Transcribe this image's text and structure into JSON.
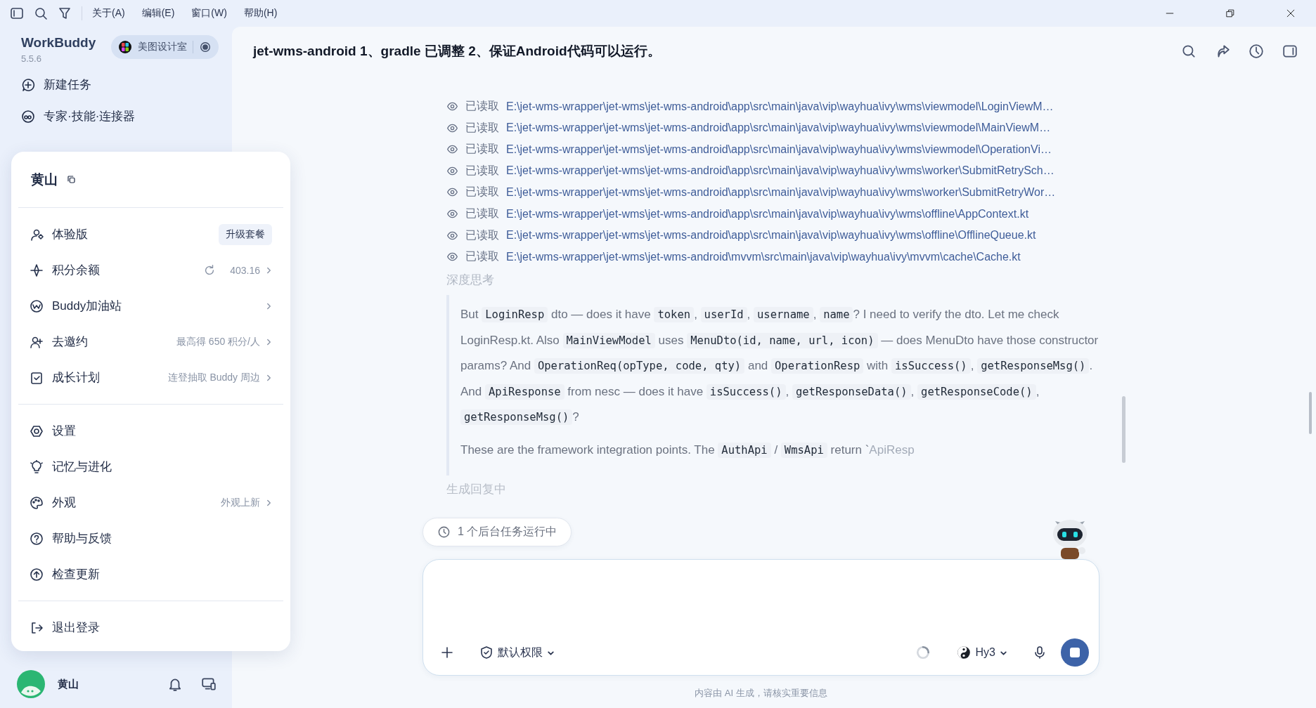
{
  "menu_bar": {
    "items": [
      "关于(A)",
      "编辑(E)",
      "窗口(W)",
      "帮助(H)"
    ]
  },
  "sidebar": {
    "app_name": "WorkBuddy",
    "version": "5.5.6",
    "workspace": "美图设计室",
    "items": [
      {
        "label": "新建任务"
      },
      {
        "label": "专家·技能·连接器"
      }
    ],
    "user": {
      "name": "黄山"
    }
  },
  "account_menu": {
    "user_name": "黄山",
    "groups": [
      [
        {
          "kind": "upgrade",
          "label": "体验版",
          "action": "升级套餐",
          "chevron": false
        },
        {
          "kind": "balance",
          "label": "积分余额",
          "detail": "403.16",
          "chevron": true
        },
        {
          "kind": "plain",
          "label": "Buddy加油站",
          "chevron": true
        },
        {
          "kind": "plain",
          "label": "去邀约",
          "detail": "最高得 650 积分/人",
          "chevron": true
        },
        {
          "kind": "plain",
          "label": "成长计划",
          "detail": "连登抽取 Buddy 周边",
          "chevron": true
        }
      ],
      [
        {
          "kind": "plain",
          "label": "设置",
          "chevron": false
        },
        {
          "kind": "plain",
          "label": "记忆与进化",
          "chevron": false
        },
        {
          "kind": "plain",
          "label": "外观",
          "detail": "外观上新",
          "chevron": true
        },
        {
          "kind": "plain",
          "label": "帮助与反馈",
          "chevron": false
        },
        {
          "kind": "plain",
          "label": "检查更新",
          "chevron": false
        }
      ],
      [
        {
          "kind": "plain",
          "label": "退出登录",
          "chevron": false
        }
      ]
    ]
  },
  "conversation": {
    "title": "jet-wms-android 1、gradle 已调整 2、保证Android代码可以运行。",
    "file_reads": [
      {
        "status": "已读取",
        "path": "E:\\jet-wms-wrapper\\jet-wms\\jet-wms-android\\app\\src\\main\\java\\vip\\wayhua\\ivy\\wms\\viewmodel\\LoginViewM…"
      },
      {
        "status": "已读取",
        "path": "E:\\jet-wms-wrapper\\jet-wms\\jet-wms-android\\app\\src\\main\\java\\vip\\wayhua\\ivy\\wms\\viewmodel\\MainViewM…"
      },
      {
        "status": "已读取",
        "path": "E:\\jet-wms-wrapper\\jet-wms\\jet-wms-android\\app\\src\\main\\java\\vip\\wayhua\\ivy\\wms\\viewmodel\\OperationVi…"
      },
      {
        "status": "已读取",
        "path": "E:\\jet-wms-wrapper\\jet-wms\\jet-wms-android\\app\\src\\main\\java\\vip\\wayhua\\ivy\\wms\\worker\\SubmitRetrySch…"
      },
      {
        "status": "已读取",
        "path": "E:\\jet-wms-wrapper\\jet-wms\\jet-wms-android\\app\\src\\main\\java\\vip\\wayhua\\ivy\\wms\\worker\\SubmitRetryWor…"
      },
      {
        "status": "已读取",
        "path": "E:\\jet-wms-wrapper\\jet-wms\\jet-wms-android\\app\\src\\main\\java\\vip\\wayhua\\ivy\\wms\\offline\\AppContext.kt"
      },
      {
        "status": "已读取",
        "path": "E:\\jet-wms-wrapper\\jet-wms\\jet-wms-android\\app\\src\\main\\java\\vip\\wayhua\\ivy\\wms\\offline\\OfflineQueue.kt"
      },
      {
        "status": "已读取",
        "path": "E:\\jet-wms-wrapper\\jet-wms\\jet-wms-android\\mvvm\\src\\main\\java\\vip\\wayhua\\ivy\\mvvm\\cache\\Cache.kt"
      }
    ],
    "thinking_label": "深度思考",
    "thinking": [
      [
        {
          "kind": "text",
          "text": "But "
        },
        {
          "kind": "code",
          "text": "LoginResp"
        },
        {
          "kind": "text",
          "text": " dto — does it have "
        },
        {
          "kind": "code",
          "text": "token"
        },
        {
          "kind": "text",
          "text": ", "
        },
        {
          "kind": "code",
          "text": "userId"
        },
        {
          "kind": "text",
          "text": ", "
        },
        {
          "kind": "code",
          "text": "username"
        },
        {
          "kind": "text",
          "text": ", "
        },
        {
          "kind": "code",
          "text": "name"
        },
        {
          "kind": "text",
          "text": "? I need to verify the dto. Let me check LoginResp.kt. Also "
        },
        {
          "kind": "code",
          "text": "MainViewModel"
        },
        {
          "kind": "text",
          "text": " uses "
        },
        {
          "kind": "code",
          "text": "MenuDto(id, name, url, icon)"
        },
        {
          "kind": "text",
          "text": " — does MenuDto have those constructor params? And "
        },
        {
          "kind": "code",
          "text": "OperationReq(opType, code, qty)"
        },
        {
          "kind": "text",
          "text": " and "
        },
        {
          "kind": "code",
          "text": "OperationResp"
        },
        {
          "kind": "text",
          "text": " with "
        },
        {
          "kind": "code",
          "text": "isSuccess()"
        },
        {
          "kind": "text",
          "text": ", "
        },
        {
          "kind": "code",
          "text": "getResponseMsg()"
        },
        {
          "kind": "text",
          "text": ". And "
        },
        {
          "kind": "code",
          "text": "ApiResponse"
        },
        {
          "kind": "text",
          "text": " from nesc — does it have "
        },
        {
          "kind": "code",
          "text": "isSuccess()"
        },
        {
          "kind": "text",
          "text": ", "
        },
        {
          "kind": "code",
          "text": "getResponseData()"
        },
        {
          "kind": "text",
          "text": ", "
        },
        {
          "kind": "code",
          "text": "getResponseCode()"
        },
        {
          "kind": "text",
          "text": ", "
        },
        {
          "kind": "code",
          "text": "getResponseMsg()"
        },
        {
          "kind": "text",
          "text": "?"
        }
      ],
      [
        {
          "kind": "text",
          "text": "These are the framework integration points. The "
        },
        {
          "kind": "code",
          "text": "AuthApi"
        },
        {
          "kind": "text",
          "text": " / "
        },
        {
          "kind": "code",
          "text": "WmsApi"
        },
        {
          "kind": "text",
          "text": " return `"
        },
        {
          "kind": "fade",
          "text": "ApiResp"
        }
      ]
    ],
    "status": "生成回复中"
  },
  "background_tasks": "1 个后台任务运行中",
  "composer": {
    "permission": "默认权限",
    "model": "Hy3"
  },
  "footer": "内容由 AI 生成，请核实重要信息"
}
